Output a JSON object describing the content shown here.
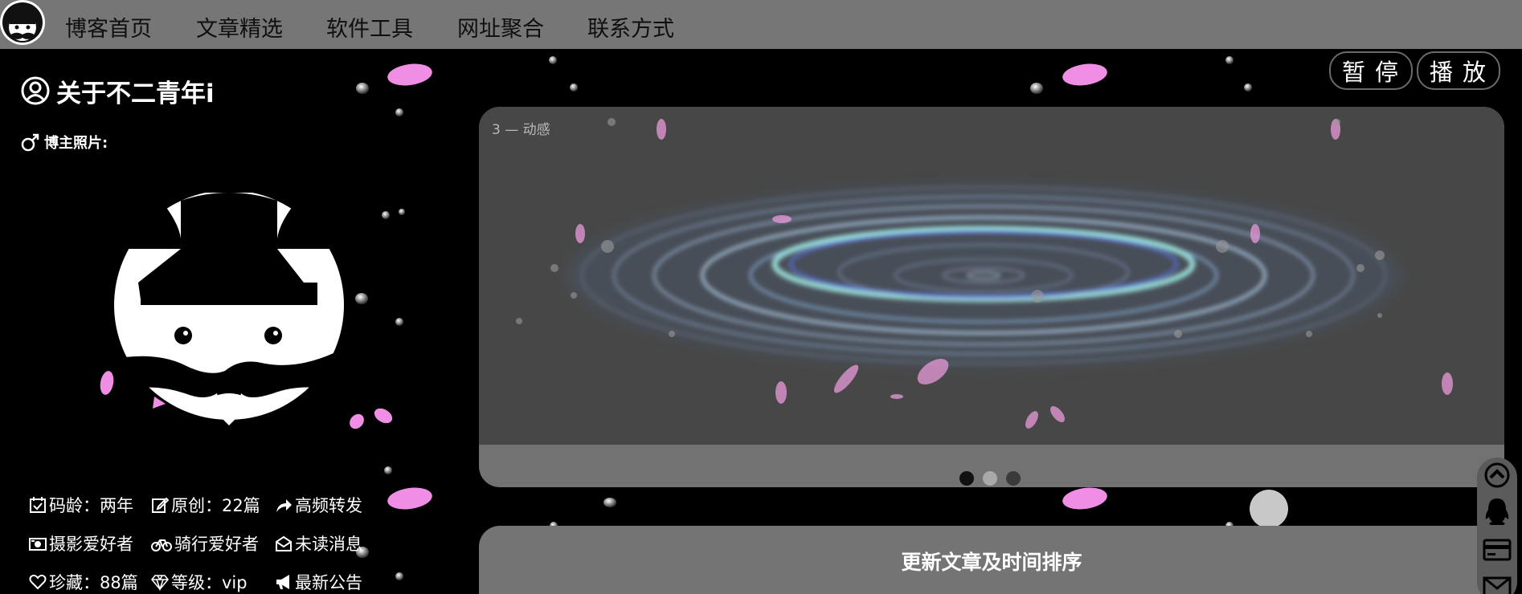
{
  "nav": {
    "items": [
      "博客首页",
      "文章精选",
      "软件工具",
      "网址聚合",
      "联系方式"
    ]
  },
  "about": {
    "title": "关于不二青年i",
    "photo_label": "博主照片:"
  },
  "stats": {
    "age_label": "码龄：两年",
    "original_label": "原创：22篇",
    "repost_label": "高频转发",
    "photo_label": "摄影爱好者",
    "cycling_label": "骑行爱好者",
    "unread_label": "未读消息",
    "favorites_label": "珍藏：88篇",
    "level_label": "等级：vip",
    "notice_label": "最新公告"
  },
  "player": {
    "pause_label": "暂停",
    "play_label": "播放"
  },
  "carousel": {
    "caption": "3 — 动感",
    "slide_count": 3,
    "active_index": 0,
    "colors": {
      "active": "#111111",
      "inactive": "#3a3a3a",
      "current": "#a9a9a9"
    }
  },
  "articles": {
    "title": "更新文章及时间排序"
  },
  "rail": {
    "icons": [
      "arrow-up-icon",
      "qq-icon",
      "card-icon",
      "mail-icon"
    ]
  },
  "theme": {
    "nav_bg": "#767676",
    "page_bg": "#000000",
    "petal": "#f08ee6",
    "panel_bg": "#727272"
  }
}
